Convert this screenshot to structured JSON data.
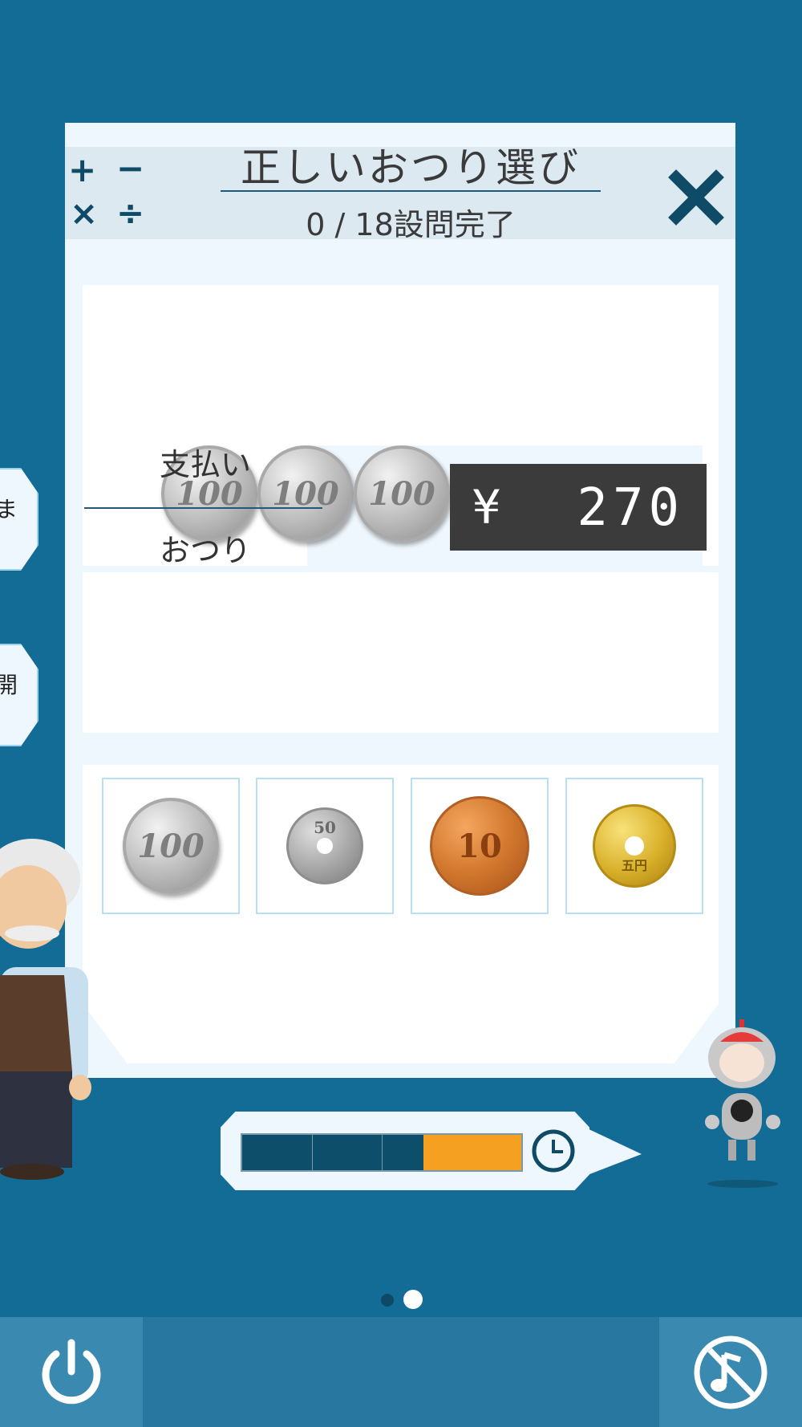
{
  "side_tabs": [
    "ま",
    "開"
  ],
  "header": {
    "operators": [
      "+",
      "−",
      "×",
      "÷"
    ],
    "title": "正しいおつり選び",
    "progress": "0 / 18設問完了"
  },
  "payment": {
    "label": "支払い",
    "coins": [
      "100",
      "100",
      "100"
    ]
  },
  "change": {
    "label": "おつり"
  },
  "display": {
    "currency": "¥",
    "amount": "270"
  },
  "coin_options": [
    {
      "value": "100",
      "name": "100-yen"
    },
    {
      "value": "50",
      "name": "50-yen"
    },
    {
      "value": "10",
      "name": "10-yen"
    },
    {
      "value": "五円",
      "name": "5-yen"
    }
  ],
  "timer": {
    "remaining_fraction": 0.35,
    "bar_color": "#0d4e6b",
    "fill_color": "#f6a022"
  },
  "pager": {
    "pages": 2,
    "current": 2
  },
  "colors": {
    "background": "#136c95",
    "card": "#eef7fd",
    "accent": "#0f4a66"
  }
}
